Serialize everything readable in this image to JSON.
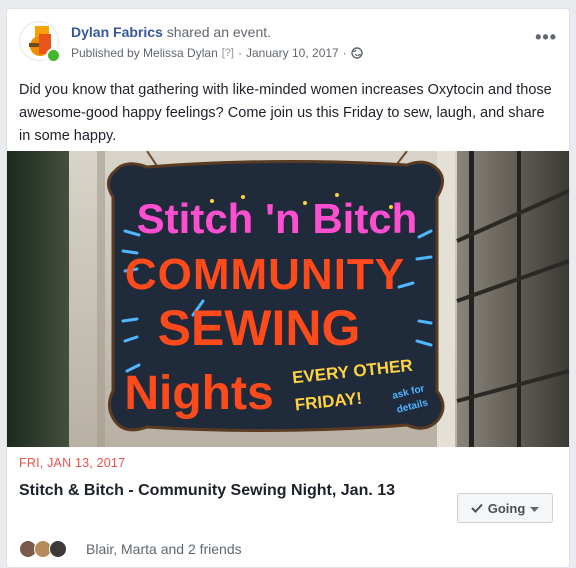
{
  "post": {
    "page_name": "Dylan Fabrics",
    "action_text": " shared an event.",
    "published_by": "Published by Melissa Dylan",
    "help_marker": "[?]",
    "separator": "·",
    "date": "January 10, 2017",
    "privacy_icon": "globe-icon",
    "more_icon": "•••",
    "body": "Did you know that gathering with like-minded women increases Oxytocin and those awesome-good happy feelings? Come join us this Friday to sew, laugh, and share in some happy."
  },
  "sign": {
    "line1": "Stitch 'n Bitch",
    "line2": "COMMUNITY",
    "line3": "SEWING",
    "line4": "Nights",
    "every_other": "EVERY OTHER",
    "friday": "FRIDAY!",
    "ask_for": "ask for",
    "details": "details"
  },
  "event": {
    "date": "FRI, JAN 13, 2017",
    "title": "Stitch & Bitch - Community Sewing Night, Jan. 13",
    "going_label": "Going",
    "friends_text": "Blair, Marta and 2 friends"
  },
  "colors": {
    "link": "#365899",
    "event_date": "#e9504d",
    "online": "#42b72a"
  }
}
